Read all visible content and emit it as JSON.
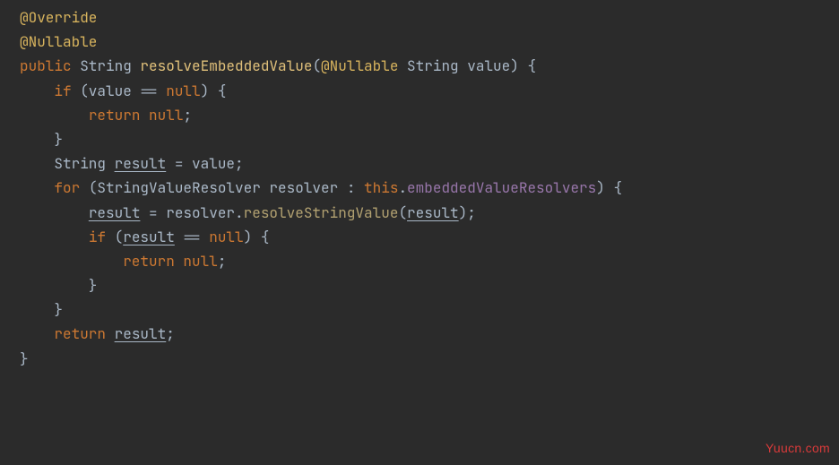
{
  "colors": {
    "background": "#2b2b2b",
    "default": "#a9b7c6",
    "annotation": "#d7b35d",
    "keyword": "#cc7832",
    "methodDecl": "#e0c07a",
    "field": "#9876aa",
    "methodCall": "#b2a171",
    "watermark": "#d93a3a"
  },
  "code": {
    "tokens": [
      [
        [
          "at",
          "@Override"
        ]
      ],
      [
        [
          "at",
          "@Nullable"
        ]
      ],
      [
        [
          "kw",
          "public"
        ],
        [
          "",
          " String "
        ],
        [
          "fn",
          "resolveEmbeddedValue"
        ],
        [
          "",
          "("
        ],
        [
          "at",
          "@Nullable"
        ],
        [
          "",
          " String value) {"
        ]
      ],
      [
        [
          "",
          "    "
        ],
        [
          "kw",
          "if"
        ],
        [
          "",
          " (value == "
        ],
        [
          "kw",
          "null"
        ],
        [
          "",
          ") {"
        ]
      ],
      [
        [
          "",
          "        "
        ],
        [
          "kw",
          "return"
        ],
        [
          "",
          " "
        ],
        [
          "kw",
          "null"
        ],
        [
          "",
          ";"
        ]
      ],
      [
        [
          "",
          "    }"
        ]
      ],
      [
        [
          "",
          "    String "
        ],
        [
          "u",
          "result"
        ],
        [
          "",
          " = value;"
        ]
      ],
      [
        [
          "",
          "    "
        ],
        [
          "kw",
          "for"
        ],
        [
          "",
          " (StringValueResolver resolver : "
        ],
        [
          "kw",
          "this"
        ],
        [
          "",
          "."
        ],
        [
          "field",
          "embeddedValueResolvers"
        ],
        [
          "",
          ") {"
        ]
      ],
      [
        [
          "",
          "        "
        ],
        [
          "u",
          "result"
        ],
        [
          "",
          " = resolver."
        ],
        [
          "call",
          "resolveStringValue"
        ],
        [
          "",
          "("
        ],
        [
          "u",
          "result"
        ],
        [
          "",
          ");"
        ]
      ],
      [
        [
          "",
          "        "
        ],
        [
          "kw",
          "if"
        ],
        [
          "",
          " ("
        ],
        [
          "u",
          "result"
        ],
        [
          "",
          " == "
        ],
        [
          "kw",
          "null"
        ],
        [
          "",
          ") {"
        ]
      ],
      [
        [
          "",
          "            "
        ],
        [
          "kw",
          "return"
        ],
        [
          "",
          " "
        ],
        [
          "kw",
          "null"
        ],
        [
          "",
          ";"
        ]
      ],
      [
        [
          "",
          "        }"
        ]
      ],
      [
        [
          "",
          "    }"
        ]
      ],
      [
        [
          "",
          "    "
        ],
        [
          "kw",
          "return"
        ],
        [
          "",
          " "
        ],
        [
          "u",
          "result"
        ],
        [
          "",
          ";"
        ]
      ],
      [
        [
          "",
          "}"
        ]
      ]
    ]
  },
  "watermark": "Yuucn.com"
}
